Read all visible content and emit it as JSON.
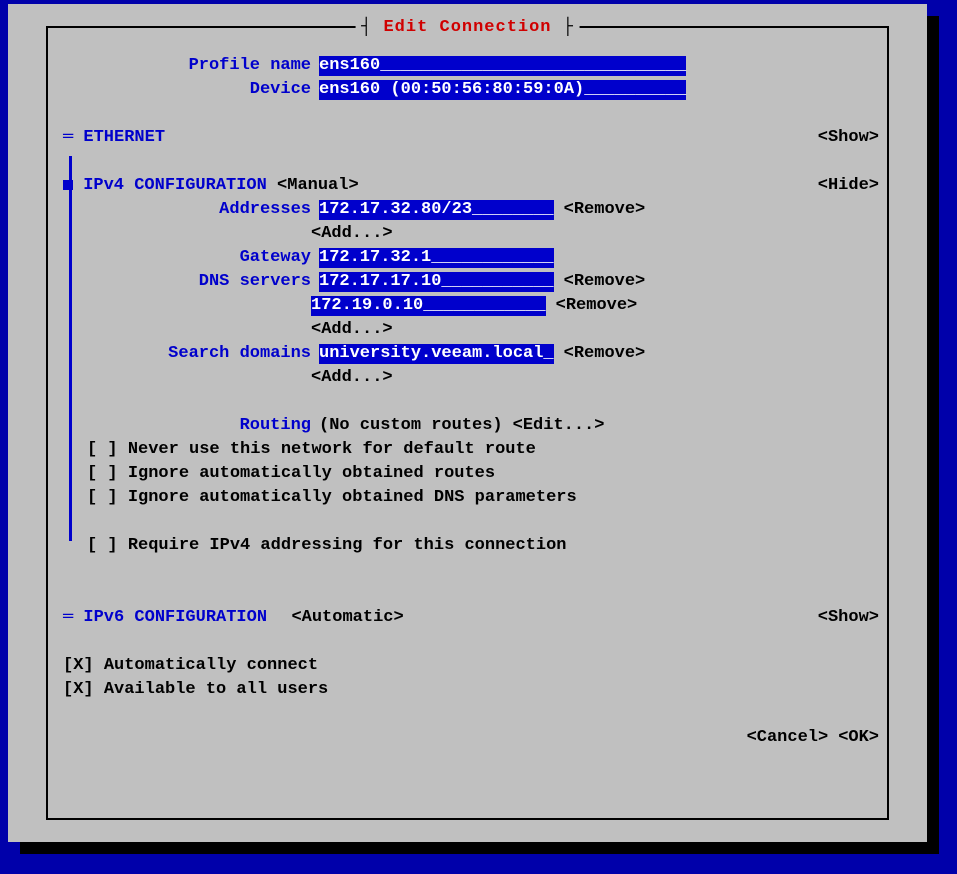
{
  "title": {
    "prefix": "┤ ",
    "main": "Edit Connection",
    "suffix": " ├"
  },
  "profile": {
    "name_label": "Profile name",
    "name_value": "ens160______________________________",
    "device_label": "Device",
    "device_value": "ens160 (00:50:56:80:59:0A)__________"
  },
  "ethernet": {
    "marker": "═",
    "label": "ETHERNET",
    "action": "<Show>"
  },
  "ipv4": {
    "label": "IPv4 CONFIGURATION",
    "mode": "<Manual>",
    "action": "<Hide>",
    "addresses_label": "Addresses",
    "addresses": [
      {
        "value": "172.17.32.80/23________",
        "remove": "<Remove>"
      }
    ],
    "add_label": "<Add...>",
    "gateway_label": "Gateway",
    "gateway": "172.17.32.1____________",
    "dns_label": "DNS servers",
    "dns": [
      {
        "value": "172.17.17.10___________",
        "remove": "<Remove>"
      },
      {
        "value": "172.19.0.10____________",
        "remove": "<Remove>"
      }
    ],
    "search_label": "Search domains",
    "search": [
      {
        "value": "university.veeam.local_",
        "remove": "<Remove>"
      }
    ],
    "routing_label": "Routing",
    "routing_text": "(No custom routes)",
    "routing_edit": "<Edit...>",
    "cb_never": "Never use this network for default route",
    "cb_ignore_routes": "Ignore automatically obtained routes",
    "cb_ignore_dns": "Ignore automatically obtained DNS parameters",
    "cb_require": "Require IPv4 addressing for this connection"
  },
  "ipv6": {
    "marker": "═",
    "label": "IPv6 CONFIGURATION",
    "mode": "<Automatic>",
    "action": "<Show>"
  },
  "bottom": {
    "cb_auto": "Automatically connect",
    "cb_all_users": "Available to all users",
    "cancel": "<Cancel>",
    "ok": "<OK>"
  },
  "cb_unchecked": "[ ] ",
  "cb_checked": "[X] "
}
